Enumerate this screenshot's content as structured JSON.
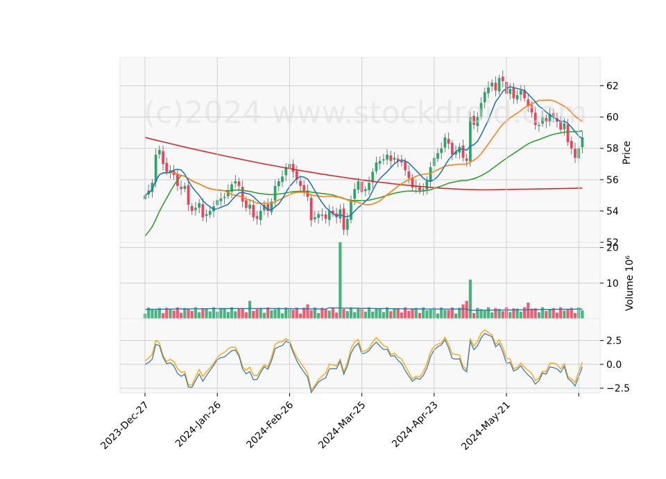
{
  "watermark": "(c)2024 www.stockdroid.com",
  "chart_data": {
    "type": "candlestick",
    "x_tick_labels": [
      "2023-Dec-27",
      "2024-Jan-26",
      "2024-Feb-26",
      "2024-Mar-25",
      "2024-Apr-23",
      "2024-May-21"
    ],
    "x_tick_index": [
      0,
      20,
      40,
      60,
      80,
      100
    ],
    "n_bars": 120,
    "grid": true,
    "colors": {
      "up": "#26a86a",
      "down": "#f0405a",
      "ma_fast": "#1f77b4",
      "ma_mid": "#ff7f0e",
      "ma_slow": "#2ca02c",
      "ma_long": "#d62728",
      "vol_avg": "#1f77b4",
      "osc_a": "#4682b4",
      "osc_b": "#ffa500",
      "panel_bg": "#f8f8f8"
    },
    "price_panel": {
      "ylabel": "Price",
      "ylim": [
        52,
        63.8
      ],
      "yticks": [
        52,
        54,
        56,
        58,
        60,
        62
      ],
      "close": [
        55.0,
        55.3,
        55.8,
        57.6,
        57.9,
        57.0,
        56.5,
        56.6,
        56.3,
        55.6,
        55.4,
        55.6,
        54.4,
        54.0,
        54.2,
        54.5,
        53.6,
        53.8,
        54.0,
        54.3,
        54.7,
        54.8,
        54.9,
        55.3,
        55.7,
        55.9,
        55.6,
        54.6,
        54.2,
        54.4,
        53.6,
        53.5,
        54.0,
        54.4,
        54.0,
        54.6,
        55.6,
        55.9,
        56.2,
        56.8,
        57.0,
        56.5,
        56.0,
        55.6,
        55.3,
        54.9,
        53.4,
        53.6,
        53.8,
        53.7,
        53.5,
        54.0,
        53.8,
        53.6,
        54.1,
        52.8,
        53.5,
        54.7,
        55.4,
        55.9,
        55.2,
        55.4,
        55.8,
        56.5,
        57.1,
        57.2,
        57.3,
        57.6,
        57.2,
        57.4,
        57.2,
        57.1,
        56.6,
        56.1,
        55.5,
        55.6,
        55.3,
        55.4,
        55.9,
        56.8,
        57.4,
        57.7,
        58.0,
        58.7,
        58.3,
        57.6,
        57.8,
        58.1,
        57.4,
        57.2,
        60.0,
        59.5,
        60.0,
        60.9,
        61.6,
        61.9,
        62.2,
        61.7,
        62.5,
        62.3,
        61.5,
        61.8,
        61.2,
        61.4,
        61.7,
        61.2,
        60.7,
        60.3,
        59.5,
        59.5,
        60.0,
        59.7,
        60.2,
        60.0,
        59.7,
        59.2,
        59.6,
        58.4,
        58.0,
        57.4,
        58.0,
        58.7
      ]
    },
    "volume_panel": {
      "ylabel": "Volume  10⁶",
      "ylim": [
        0,
        21.5
      ],
      "yticks": [
        10,
        20
      ],
      "vol_avg_level": 2.6
    },
    "osc_panel": {
      "ylim": [
        -3.0,
        4.8
      ],
      "yticks": [
        2.5,
        0.0,
        -2.5
      ],
      "ytick_labels": [
        "2.5",
        "0.0",
        "−2.5"
      ]
    }
  }
}
